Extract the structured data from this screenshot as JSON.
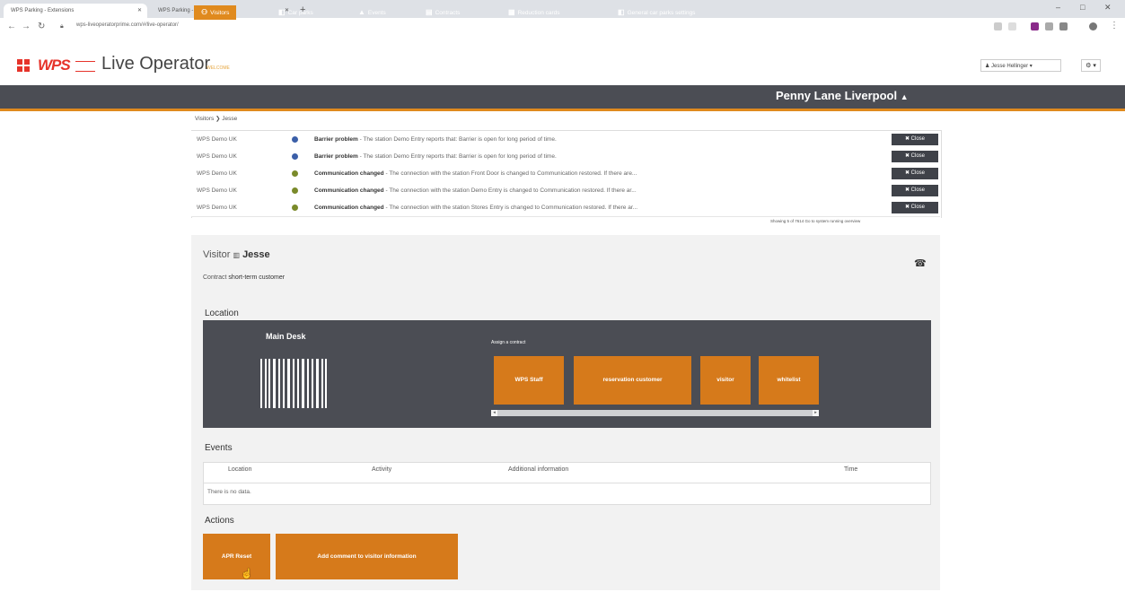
{
  "browser": {
    "tabs": [
      {
        "label": "WPS Parking - Extensions",
        "close": "✕"
      },
      {
        "label": "WPS Parking - Enterprise",
        "close": "✕"
      }
    ],
    "new_tab": "+",
    "window_controls": [
      "–",
      "□",
      "✕"
    ],
    "url": "wps-liveoperatorprime.com/#/live-operator/"
  },
  "app": {
    "title": "Live Operator",
    "subtitle": "WELCOME",
    "user": "Jesse Hellinger ▾",
    "settings": "⚙ ▾"
  },
  "nav": {
    "items": [
      {
        "icon": "⚇",
        "label": "Visitors"
      },
      {
        "icon": "◧",
        "label": "Car parks"
      },
      {
        "icon": "▲",
        "label": "Events"
      },
      {
        "icon": "▤",
        "label": "Contracts"
      },
      {
        "icon": "▦",
        "label": "Reduction cards"
      },
      {
        "icon": "◧",
        "label": "General car parks settings"
      }
    ],
    "location": "Penny Lane Liverpool",
    "bell": "🔔"
  },
  "breadcrumb": "Visitors ❯ Jesse",
  "notifications": [
    {
      "source": "WPS Demo UK",
      "title": "Barrier problem",
      "text": " - The station Demo Entry reports that: Barrier is open for long period of time.",
      "color": "#3b5fa8",
      "close": "✖ Close"
    },
    {
      "source": "WPS Demo UK",
      "title": "Barrier problem",
      "text": " - The station Demo Entry reports that: Barrier is open for long period of time.",
      "color": "#3b5fa8",
      "close": "✖ Close"
    },
    {
      "source": "WPS Demo UK",
      "title": "Communication changed",
      "text": " - The connection with the station Front Door is changed to Communication restored. If there are...",
      "color": "#7a8a2a",
      "close": "✖ Close"
    },
    {
      "source": "WPS Demo UK",
      "title": "Communication changed",
      "text": " - The connection with the station Demo Entry is changed to Communication restored. If there ar...",
      "color": "#7a8a2a",
      "close": "✖ Close"
    },
    {
      "source": "WPS Demo UK",
      "title": "Communication changed",
      "text": " - The connection with the station Stores Entry is changed to Communication restored. If there ar...",
      "color": "#7a8a2a",
      "close": "✖ Close"
    }
  ],
  "showing": "Showing 5 of 7614  Go to system running overview",
  "visitor": {
    "label": "Visitor",
    "icon": "▥",
    "name": "Jesse",
    "contract_label": "Contract",
    "contract_value": "short-term customer",
    "phone": "☎"
  },
  "location": {
    "heading": "Location",
    "desk": "Main Desk",
    "assign_label": "Assign a contract",
    "contracts": [
      "WPS Staff",
      "reservation customer",
      "visitor",
      "whitelist"
    ],
    "scroll_left": "◂",
    "scroll_right": "▸"
  },
  "events": {
    "heading": "Events",
    "columns": [
      "Location",
      "Activity",
      "Additional information",
      "Time"
    ],
    "empty": "There is no data."
  },
  "actions": {
    "heading": "Actions",
    "buttons": [
      "APR Reset",
      "Add comment to visitor information"
    ]
  },
  "colors": {
    "accent": "#e08a1e",
    "dark": "#4b4d54",
    "logo": "#e6332a"
  }
}
